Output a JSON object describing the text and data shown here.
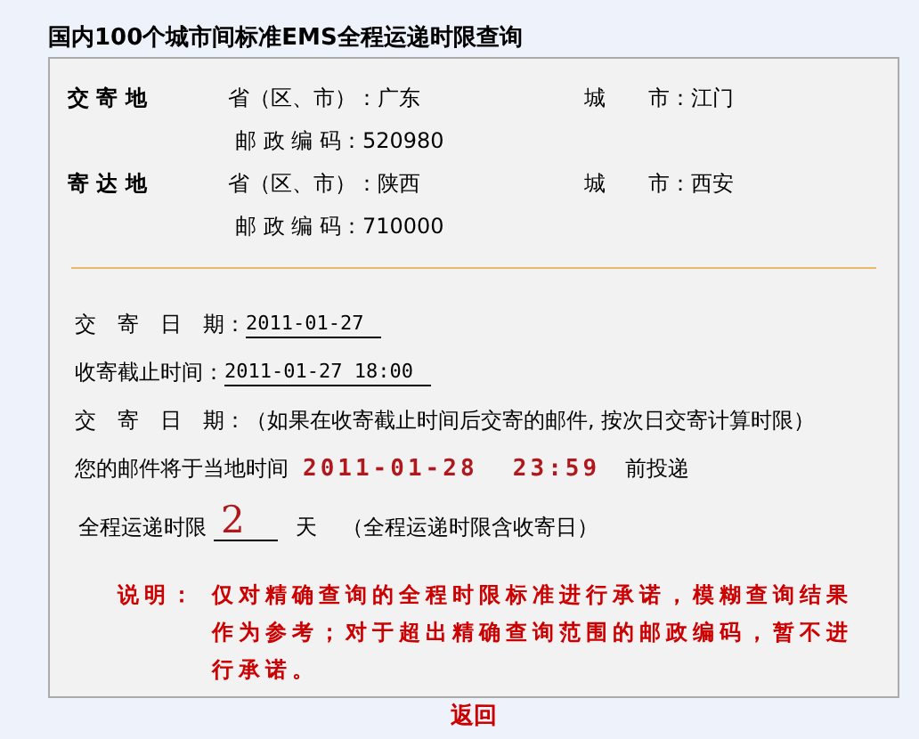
{
  "title": "国内100个城市间标准EMS全程运递时限查询",
  "addresses": [
    {
      "label": "交 寄 地",
      "province_label": "省（区、市）：",
      "province": "广东",
      "city_label": "城　　市：",
      "city": "江门",
      "postcode_label": "邮 政 编 码：",
      "postcode": "520980"
    },
    {
      "label": "寄 达 地",
      "province_label": "省（区、市）：",
      "province": "陕西",
      "city_label": "城　　市：",
      "city": "西安",
      "postcode_label": "邮 政 编 码：",
      "postcode": "710000"
    }
  ],
  "details": [
    {
      "kind": "field",
      "label": "交　寄　日　期：",
      "value": "2011-01-27"
    },
    {
      "kind": "field",
      "label": "收寄截止时间：",
      "value": "2011-01-27 18:00"
    },
    {
      "kind": "note",
      "label": "交　寄　日　期：",
      "value": "（如果在收寄截止时间后交寄的邮件, 按次日交寄计算时限）"
    }
  ],
  "delivery": {
    "prefix": "您的邮件将于当地时间",
    "time": "2011-01-28  23:59",
    "suffix": "前投递"
  },
  "duration": {
    "label": "全程运递时限",
    "value": "2",
    "unit": "天",
    "note": "（全程运递时限含收寄日）"
  },
  "notice": {
    "label": "说明：",
    "text": "仅对精确查询的全程时限标准进行承诺，模糊查询结果作为参考；对于超出精确查询范围的邮政编码，暂不进行承诺。"
  },
  "back_link": "返回"
}
